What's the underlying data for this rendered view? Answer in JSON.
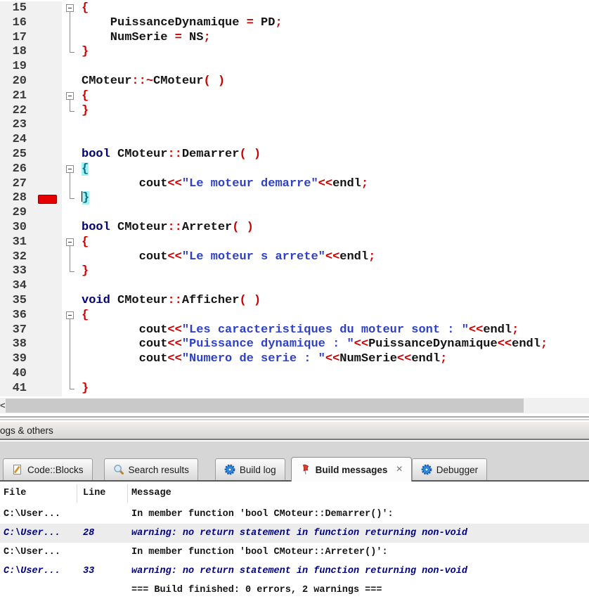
{
  "editor": {
    "lines": [
      {
        "n": "15",
        "fold": "open",
        "tokens": [
          [
            "o",
            "{"
          ]
        ]
      },
      {
        "n": "16",
        "fold": "mid",
        "tokens": [
          [
            "p",
            "    PuissanceDynamique "
          ],
          [
            "o",
            "="
          ],
          [
            "p",
            " PD"
          ],
          [
            "o",
            ";"
          ]
        ]
      },
      {
        "n": "17",
        "fold": "mid",
        "tokens": [
          [
            "p",
            "    NumSerie "
          ],
          [
            "o",
            "="
          ],
          [
            "p",
            " NS"
          ],
          [
            "o",
            ";"
          ]
        ]
      },
      {
        "n": "18",
        "fold": "end",
        "tokens": [
          [
            "o",
            "}"
          ]
        ]
      },
      {
        "n": "19",
        "tokens": []
      },
      {
        "n": "20",
        "tokens": [
          [
            "p",
            "CMoteur"
          ],
          [
            "o",
            "::~"
          ],
          [
            "p",
            "CMoteur"
          ],
          [
            "o",
            "( )"
          ]
        ]
      },
      {
        "n": "21",
        "fold": "open",
        "tokens": [
          [
            "o",
            "{"
          ]
        ]
      },
      {
        "n": "22",
        "fold": "end",
        "tokens": [
          [
            "o",
            "}"
          ]
        ]
      },
      {
        "n": "23",
        "tokens": []
      },
      {
        "n": "24",
        "tokens": []
      },
      {
        "n": "25",
        "tokens": [
          [
            "k",
            "bool"
          ],
          [
            "p",
            " CMoteur"
          ],
          [
            "o",
            "::"
          ],
          [
            "p",
            "Demarrer"
          ],
          [
            "o",
            "( )"
          ]
        ]
      },
      {
        "n": "26",
        "fold": "open",
        "tokens": [
          [
            "h",
            "{"
          ]
        ]
      },
      {
        "n": "27",
        "fold": "mid",
        "tokens": [
          [
            "p",
            "        cout"
          ],
          [
            "o",
            "<<"
          ],
          [
            "s",
            "\"Le moteur demarre\""
          ],
          [
            "o",
            "<<"
          ],
          [
            "p",
            "endl"
          ],
          [
            "o",
            ";"
          ]
        ]
      },
      {
        "n": "28",
        "fold": "end",
        "marker": true,
        "caret": true,
        "tokens": [
          [
            "h",
            "}"
          ]
        ]
      },
      {
        "n": "29",
        "tokens": []
      },
      {
        "n": "30",
        "tokens": [
          [
            "k",
            "bool"
          ],
          [
            "p",
            " CMoteur"
          ],
          [
            "o",
            "::"
          ],
          [
            "p",
            "Arreter"
          ],
          [
            "o",
            "( )"
          ]
        ]
      },
      {
        "n": "31",
        "fold": "open",
        "tokens": [
          [
            "o",
            "{"
          ]
        ]
      },
      {
        "n": "32",
        "fold": "mid",
        "tokens": [
          [
            "p",
            "        cout"
          ],
          [
            "o",
            "<<"
          ],
          [
            "s",
            "\"Le moteur s arrete\""
          ],
          [
            "o",
            "<<"
          ],
          [
            "p",
            "endl"
          ],
          [
            "o",
            ";"
          ]
        ]
      },
      {
        "n": "33",
        "fold": "end",
        "tokens": [
          [
            "o",
            "}"
          ]
        ]
      },
      {
        "n": "34",
        "tokens": []
      },
      {
        "n": "35",
        "tokens": [
          [
            "k",
            "void"
          ],
          [
            "p",
            " CMoteur"
          ],
          [
            "o",
            "::"
          ],
          [
            "p",
            "Afficher"
          ],
          [
            "o",
            "( )"
          ]
        ]
      },
      {
        "n": "36",
        "fold": "open",
        "tokens": [
          [
            "o",
            "{"
          ]
        ]
      },
      {
        "n": "37",
        "fold": "mid",
        "tokens": [
          [
            "p",
            "        cout"
          ],
          [
            "o",
            "<<"
          ],
          [
            "s",
            "\"Les caracteristiques du moteur sont : \""
          ],
          [
            "o",
            "<<"
          ],
          [
            "p",
            "endl"
          ],
          [
            "o",
            ";"
          ]
        ]
      },
      {
        "n": "38",
        "fold": "mid",
        "tokens": [
          [
            "p",
            "        cout"
          ],
          [
            "o",
            "<<"
          ],
          [
            "s",
            "\"Puissance dynamique : \""
          ],
          [
            "o",
            "<<"
          ],
          [
            "p",
            "PuissanceDynamique"
          ],
          [
            "o",
            "<<"
          ],
          [
            "p",
            "endl"
          ],
          [
            "o",
            ";"
          ]
        ]
      },
      {
        "n": "39",
        "fold": "mid",
        "tokens": [
          [
            "p",
            "        cout"
          ],
          [
            "o",
            "<<"
          ],
          [
            "s",
            "\"Numero de serie : \""
          ],
          [
            "o",
            "<<"
          ],
          [
            "p",
            "NumSerie"
          ],
          [
            "o",
            "<<"
          ],
          [
            "p",
            "endl"
          ],
          [
            "o",
            ";"
          ]
        ]
      },
      {
        "n": "40",
        "fold": "mid",
        "tokens": []
      },
      {
        "n": "41",
        "fold": "end",
        "tokens": [
          [
            "o",
            "}"
          ]
        ]
      }
    ]
  },
  "scrollbar": {
    "left_arrow": "<"
  },
  "logs": {
    "caption": "ogs & others",
    "tabs": [
      {
        "id": "code-blocks",
        "label": "Code::Blocks",
        "icon": "page-pencil",
        "active": false
      },
      {
        "id": "search-results",
        "label": "Search results",
        "icon": "search",
        "active": false
      },
      {
        "id": "build-log",
        "label": "Build log",
        "icon": "gear",
        "active": false
      },
      {
        "id": "build-messages",
        "label": "Build messages",
        "icon": "flag",
        "active": true,
        "close": "×"
      },
      {
        "id": "debugger",
        "label": "Debugger",
        "icon": "gear",
        "active": false
      }
    ]
  },
  "table": {
    "headers": [
      "File",
      "Line",
      "Message"
    ],
    "rows": [
      {
        "file": "C:\\User...",
        "line": "",
        "message": "In member function 'bool CMoteur::Demarrer()':",
        "kind": "normal",
        "selected": false
      },
      {
        "file": "C:\\User...",
        "line": "28",
        "message": "warning: no return statement in function returning non-void",
        "kind": "warning",
        "selected": true
      },
      {
        "file": "C:\\User...",
        "line": "",
        "message": "In member function 'bool CMoteur::Arreter()':",
        "kind": "normal",
        "selected": false
      },
      {
        "file": "C:\\User...",
        "line": "33",
        "message": "warning: no return statement in function returning non-void",
        "kind": "warning",
        "selected": false
      },
      {
        "file": "",
        "line": "",
        "message": "=== Build finished: 0 errors, 2 warnings ===",
        "kind": "normal",
        "selected": false
      }
    ]
  },
  "colors": {
    "keyword": "#00007F",
    "string": "#2E41C8",
    "operator": "#CC0000",
    "brace_highlight_bg": "#A5F2F3",
    "error_marker": "#E40000",
    "warning_text": "#000080",
    "gutter_bg": "#F1F1F1",
    "selected_row_bg": "#ECECEC",
    "tab_active_bg": "#FCFCFC"
  }
}
